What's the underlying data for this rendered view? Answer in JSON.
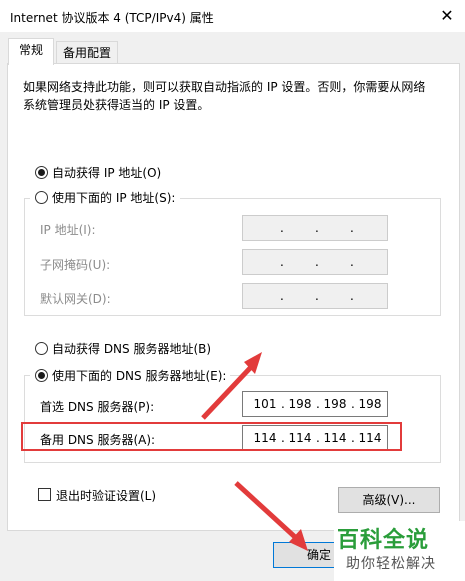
{
  "window": {
    "title": "Internet 协议版本 4 (TCP/IPv4) 属性",
    "close_glyph": "✕"
  },
  "tabs": [
    {
      "label": "常规"
    },
    {
      "label": "备用配置"
    }
  ],
  "description": "如果网络支持此功能，则可以获取自动指派的 IP 设置。否则，你需要从网络系统管理员处获得适当的 IP 设置。",
  "ip": {
    "auto_label": "自动获得 IP 地址(O)",
    "manual_label": "使用下面的 IP 地址(S):",
    "fields": [
      {
        "label": "IP 地址(I):"
      },
      {
        "label": "子网掩码(U):"
      },
      {
        "label": "默认网关(D):"
      }
    ]
  },
  "dns": {
    "auto_label": "自动获得 DNS 服务器地址(B)",
    "manual_label": "使用下面的 DNS 服务器地址(E):",
    "preferred": {
      "label": "首选 DNS 服务器(P):",
      "octets": [
        "101",
        "198",
        "198",
        "198"
      ]
    },
    "alternate": {
      "label": "备用 DNS 服务器(A):",
      "octets": [
        "114",
        "114",
        "114",
        "114"
      ]
    }
  },
  "validate_label": "退出时验证设置(L)",
  "advanced_label": "高级(V)...",
  "ok_label": "确定",
  "watermark": {
    "main": "百科全说",
    "sub": "助你轻松解决"
  },
  "colors": {
    "annotation_red": "#e23b3b",
    "watermark_green": "#2a9d3a"
  }
}
